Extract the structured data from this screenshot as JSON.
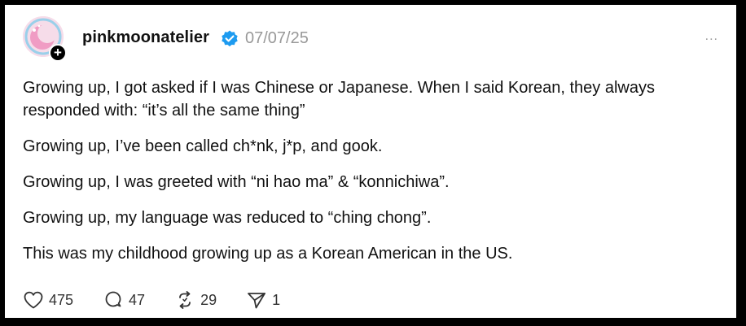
{
  "post": {
    "username": "pinkmoonatelier",
    "date": "07/07/25",
    "more_label": "...",
    "follow_symbol": "+",
    "paragraphs": [
      "Growing up, I got asked if I was Chinese or Japanese. When I said Korean, they always responded with: “it’s all the same thing”",
      "Growing up, I’ve been called ch*nk, j*p, and gook.",
      "Growing up, I was greeted with “ni hao ma” & “konnichiwa”.",
      "Growing up, my language was reduced to “ching chong”.",
      "This was my childhood growing up as a Korean American in the US."
    ]
  },
  "actions": {
    "likes": "475",
    "replies": "47",
    "reposts": "29",
    "shares": "1"
  },
  "icons": {
    "verified": "verified-badge-icon",
    "like": "heart-icon",
    "reply": "speech-bubble-icon",
    "repost": "repost-arrows-icon",
    "share": "paper-plane-icon",
    "more": "more-dots-icon"
  },
  "colors": {
    "verified_blue": "#1d9bf0",
    "avatar_pink": "#f3d6e6",
    "text": "#111111",
    "muted": "#999999"
  }
}
